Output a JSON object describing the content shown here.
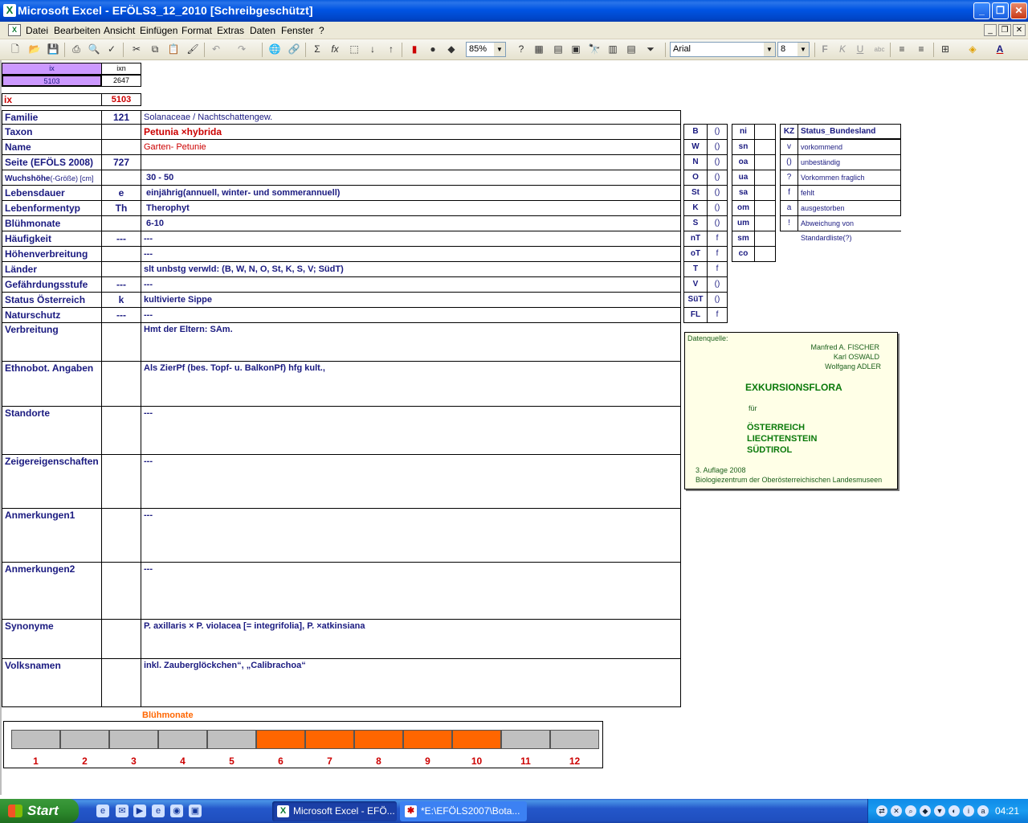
{
  "window": {
    "title": "Microsoft Excel - EFÖLS3_12_2010  [Schreibgeschützt]"
  },
  "menu": {
    "items": [
      "Datei",
      "Bearbeiten",
      "Ansicht",
      "Einfügen",
      "Format",
      "Extras",
      "Daten",
      "Fenster",
      "?"
    ]
  },
  "toolbar": {
    "zoom": "85%",
    "font_name": "Arial",
    "font_size": "8",
    "format_buttons": [
      "F",
      "K",
      "U"
    ],
    "sigma": "Σ",
    "fx": "fx"
  },
  "index": {
    "ix_header": "ix",
    "ixn_header": "ixn",
    "ix_value": "5103",
    "ixn_value": "2647",
    "ix_label": "ix",
    "ix_value_red": "5103"
  },
  "record": {
    "rows": [
      {
        "label": "Familie",
        "code": "121",
        "value": "Solanaceae  /  Nachtschattengew."
      },
      {
        "label": "Taxon",
        "code": "",
        "value": "Petunia ×hybrida"
      },
      {
        "label": "Name",
        "code": "",
        "value": "Garten- Petunie"
      },
      {
        "label": "Seite (EFÖLS 2008)",
        "code": "727",
        "value": ""
      },
      {
        "label": "Wuchshöhe",
        "label_suffix": "(-Größe) [cm]",
        "code": "",
        "value": "30 - 50"
      },
      {
        "label": "Lebensdauer",
        "code": "e",
        "value": "einjährig(annuell, winter- und sommerannuell)"
      },
      {
        "label": "Lebenformentyp",
        "code": "Th",
        "value": "Therophyt"
      },
      {
        "label": "Blühmonate",
        "code": "",
        "value": "6-10"
      },
      {
        "label": "Häufigkeit",
        "code": "---",
        "value": "---"
      },
      {
        "label": "Höhenverbreitung",
        "code": "",
        "value": "---"
      },
      {
        "label": "Länder",
        "code": "",
        "value": "slt unbstg verwld: (B, W, N, O, St, K, S, V; SüdT)"
      },
      {
        "label": "Gefährdungsstufe",
        "code": "---",
        "value": "---"
      },
      {
        "label": "Status Österreich",
        "code": "k",
        "value": "kultivierte Sippe"
      },
      {
        "label": "Naturschutz",
        "code": "---",
        "value": "---"
      },
      {
        "label": "Verbreitung",
        "code": "",
        "value": "Hmt der Eltern: SAm."
      },
      {
        "label": "Ethnobot. Angaben",
        "code": "",
        "value": "Als ZierPf (bes. Topf- u. BalkonPf) hfg kult.,"
      },
      {
        "label": "Standorte",
        "code": "",
        "value": "---"
      },
      {
        "label": "Zeigereigenschaften",
        "code": "",
        "value": "---"
      },
      {
        "label": "Anmerkungen1",
        "code": "",
        "value": "---"
      },
      {
        "label": "Anmerkungen2",
        "code": "",
        "value": "---"
      },
      {
        "label": "Synonyme",
        "code": "",
        "value": "P. axillaris × P. violacea [= integrifolia], P. ×atkinsiana"
      },
      {
        "label": "Volksnamen",
        "code": "",
        "value": "inkl. Zauberglöckchen“, „Calibrachoa“"
      }
    ]
  },
  "states": [
    {
      "abbr": "B",
      "status": "()"
    },
    {
      "abbr": "W",
      "status": "()"
    },
    {
      "abbr": "N",
      "status": "()"
    },
    {
      "abbr": "O",
      "status": "()"
    },
    {
      "abbr": "St",
      "status": "()"
    },
    {
      "abbr": "K",
      "status": "()"
    },
    {
      "abbr": "S",
      "status": "()"
    },
    {
      "abbr": "nT",
      "status": "f"
    },
    {
      "abbr": "oT",
      "status": "f"
    },
    {
      "abbr": "T",
      "status": "f"
    },
    {
      "abbr": "V",
      "status": "()"
    },
    {
      "abbr": "SüT",
      "status": "()"
    },
    {
      "abbr": "FL",
      "status": "f"
    }
  ],
  "altitude": [
    {
      "abbr": "ni",
      "status": ""
    },
    {
      "abbr": "sn",
      "status": ""
    },
    {
      "abbr": "oa",
      "status": ""
    },
    {
      "abbr": "ua",
      "status": ""
    },
    {
      "abbr": "sa",
      "status": ""
    },
    {
      "abbr": "om",
      "status": ""
    },
    {
      "abbr": "um",
      "status": ""
    },
    {
      "abbr": "sm",
      "status": ""
    },
    {
      "abbr": "co",
      "status": ""
    }
  ],
  "status_legend": {
    "header_kz": "KZ",
    "header_label": "Status_Bundesland",
    "items": [
      {
        "kz": "v",
        "label": "vorkommend"
      },
      {
        "kz": "()",
        "label": "unbeständig"
      },
      {
        "kz": "?",
        "label": "Vorkommen fraglich"
      },
      {
        "kz": "f",
        "label": "fehlt"
      },
      {
        "kz": "a",
        "label": "ausgestorben"
      },
      {
        "kz": "!",
        "label": "Abweichung von Standardliste(?)"
      }
    ]
  },
  "source": {
    "label": "Datenquelle:",
    "author1": "Manfred A. FISCHER",
    "author2": "Karl OSWALD",
    "author3": "Wolfgang ADLER",
    "title": "EXKURSIONSFLORA",
    "fuer": "für",
    "region1": "ÖSTERREICH",
    "region2": "LIECHTENSTEIN",
    "region3": "SÜDTIROL",
    "edition": "3. Auflage 2008",
    "publisher": "Biologiezentrum der Oberösterreichischen Landesmuseen"
  },
  "chart_data": {
    "type": "bar",
    "title": "Blühmonate",
    "categories": [
      "1",
      "2",
      "3",
      "4",
      "5",
      "6",
      "7",
      "8",
      "9",
      "10",
      "11",
      "12"
    ],
    "values": [
      0,
      0,
      0,
      0,
      0,
      1,
      1,
      1,
      1,
      1,
      0,
      0
    ],
    "colors": {
      "active": "#ff6600",
      "inactive": "#c0c0c0",
      "labels": "#cc0000"
    }
  },
  "taskbar": {
    "start": "Start",
    "tasks": [
      {
        "label": "Microsoft Excel - EFÖ..."
      },
      {
        "label": "*E:\\EFÖLS2007\\Bota..."
      }
    ],
    "clock": "04:21"
  }
}
